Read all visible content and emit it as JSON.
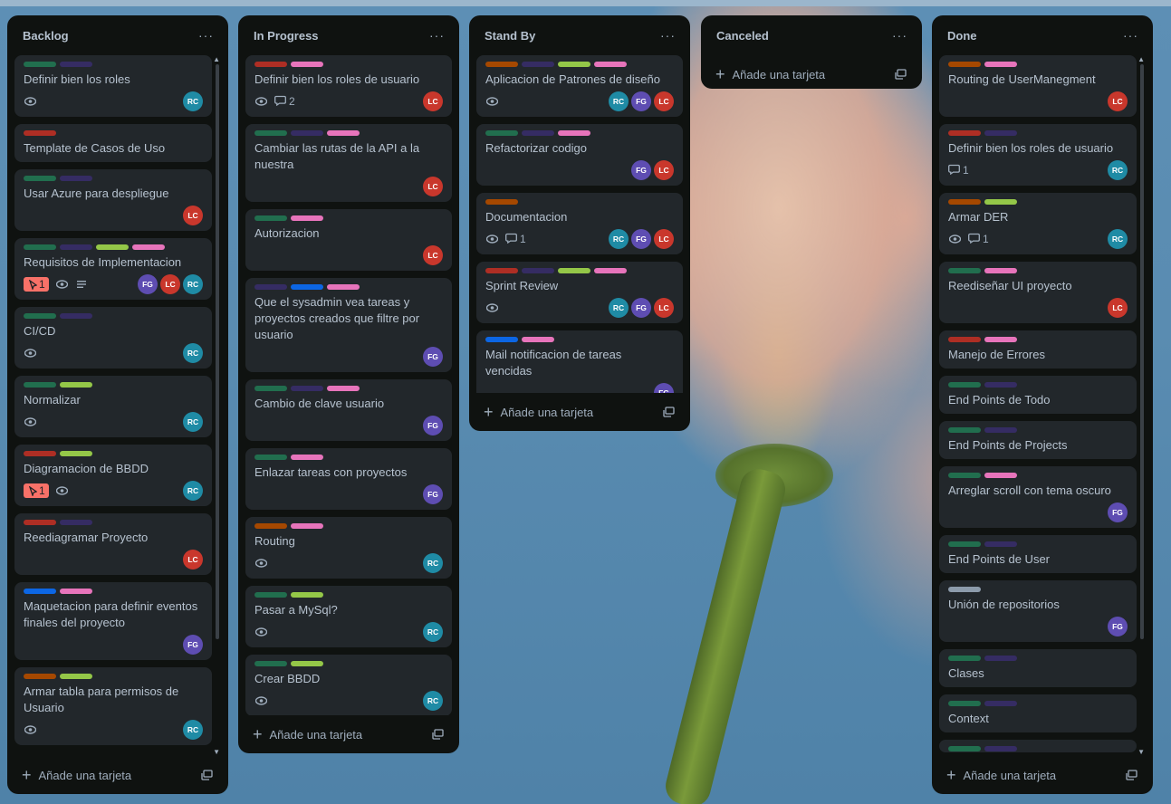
{
  "lists": [
    {
      "title": "Backlog",
      "add_label": "Añade una tarjeta",
      "cards": [
        {
          "labels": [
            "#216e4e",
            "#352c63"
          ],
          "title": "Definir bien los roles",
          "watch": true,
          "comments": "",
          "due": "",
          "desc": false,
          "members": [
            "RC"
          ]
        },
        {
          "labels": [
            "#ae2e24"
          ],
          "title": "Template de Casos de Uso",
          "watch": false,
          "comments": "",
          "due": "",
          "desc": false,
          "members": []
        },
        {
          "labels": [
            "#216e4e",
            "#352c63"
          ],
          "title": "Usar Azure para despliegue",
          "watch": false,
          "comments": "",
          "due": "",
          "desc": false,
          "members": [
            "LC"
          ]
        },
        {
          "labels": [
            "#216e4e",
            "#352c63",
            "#94c748",
            "#e774bb"
          ],
          "title": "Requisitos de Implementacion",
          "watch": true,
          "comments": "",
          "due": "1",
          "desc": true,
          "members": [
            "FG",
            "LC",
            "RC"
          ]
        },
        {
          "labels": [
            "#216e4e",
            "#352c63"
          ],
          "title": "CI/CD",
          "watch": true,
          "comments": "",
          "due": "",
          "desc": false,
          "members": [
            "RC"
          ]
        },
        {
          "labels": [
            "#216e4e",
            "#94c748"
          ],
          "title": "Normalizar",
          "watch": true,
          "comments": "",
          "due": "",
          "desc": false,
          "members": [
            "RC"
          ]
        },
        {
          "labels": [
            "#ae2e24",
            "#94c748"
          ],
          "title": "Diagramacion de BBDD",
          "watch": true,
          "comments": "",
          "due": "1",
          "desc": false,
          "members": [
            "RC"
          ]
        },
        {
          "labels": [
            "#ae2e24",
            "#352c63"
          ],
          "title": "Reediagramar Proyecto",
          "watch": false,
          "comments": "",
          "due": "",
          "desc": false,
          "members": [
            "LC"
          ]
        },
        {
          "labels": [
            "#0c66e4",
            "#e774bb"
          ],
          "title": "Maquetacion para definir eventos finales del proyecto",
          "watch": false,
          "comments": "",
          "due": "",
          "desc": false,
          "members": [
            "FG"
          ]
        },
        {
          "labels": [
            "#a54800",
            "#94c748"
          ],
          "title": "Armar tabla para permisos de Usuario",
          "watch": true,
          "comments": "",
          "due": "",
          "desc": false,
          "members": [
            "RC"
          ]
        }
      ]
    },
    {
      "title": "In Progress",
      "add_label": "Añade una tarjeta",
      "cards": [
        {
          "labels": [
            "#ae2e24",
            "#e774bb"
          ],
          "title": "Definir bien los roles de usuario",
          "watch": true,
          "comments": "2",
          "due": "",
          "desc": false,
          "members": [
            "LC"
          ]
        },
        {
          "labels": [
            "#216e4e",
            "#352c63",
            "#e774bb"
          ],
          "title": "Cambiar las rutas de la API a la nuestra",
          "watch": false,
          "comments": "",
          "due": "",
          "desc": false,
          "members": [
            "LC"
          ]
        },
        {
          "labels": [
            "#216e4e",
            "#e774bb"
          ],
          "title": "Autorizacion",
          "watch": false,
          "comments": "",
          "due": "",
          "desc": false,
          "members": [
            "LC"
          ]
        },
        {
          "labels": [
            "#352c63",
            "#0c66e4",
            "#e774bb"
          ],
          "title": "Que el sysadmin vea tareas y proyectos creados que filtre por usuario",
          "watch": false,
          "comments": "",
          "due": "",
          "desc": false,
          "members": [
            "FG"
          ]
        },
        {
          "labels": [
            "#216e4e",
            "#352c63",
            "#e774bb"
          ],
          "title": "Cambio de clave usuario",
          "watch": false,
          "comments": "",
          "due": "",
          "desc": false,
          "members": [
            "FG"
          ]
        },
        {
          "labels": [
            "#216e4e",
            "#e774bb"
          ],
          "title": "Enlazar tareas con proyectos",
          "watch": false,
          "comments": "",
          "due": "",
          "desc": false,
          "members": [
            "FG"
          ]
        },
        {
          "labels": [
            "#a54800",
            "#e774bb"
          ],
          "title": "Routing",
          "watch": true,
          "comments": "",
          "due": "",
          "desc": false,
          "members": [
            "RC"
          ]
        },
        {
          "labels": [
            "#216e4e",
            "#94c748"
          ],
          "title": "Pasar a MySql?",
          "watch": true,
          "comments": "",
          "due": "",
          "desc": false,
          "members": [
            "RC"
          ]
        },
        {
          "labels": [
            "#216e4e",
            "#94c748"
          ],
          "title": "Crear BBDD",
          "watch": true,
          "comments": "",
          "due": "",
          "desc": false,
          "members": [
            "RC"
          ]
        }
      ]
    },
    {
      "title": "Stand By",
      "add_label": "Añade una tarjeta",
      "cards": [
        {
          "labels": [
            "#a54800",
            "#352c63",
            "#94c748",
            "#e774bb"
          ],
          "title": "Aplicacion de Patrones de diseño",
          "watch": true,
          "comments": "",
          "due": "",
          "desc": false,
          "members": [
            "RC",
            "FG",
            "LC"
          ]
        },
        {
          "labels": [
            "#216e4e",
            "#352c63",
            "#e774bb"
          ],
          "title": "Refactorizar codigo",
          "watch": false,
          "comments": "",
          "due": "",
          "desc": false,
          "members": [
            "FG",
            "LC"
          ]
        },
        {
          "labels": [
            "#a54800"
          ],
          "title": "Documentacion",
          "watch": true,
          "comments": "1",
          "due": "",
          "desc": false,
          "members": [
            "RC",
            "FG",
            "LC"
          ]
        },
        {
          "labels": [
            "#ae2e24",
            "#352c63",
            "#94c748",
            "#e774bb"
          ],
          "title": "Sprint Review",
          "watch": true,
          "comments": "",
          "due": "",
          "desc": false,
          "members": [
            "RC",
            "FG",
            "LC"
          ]
        },
        {
          "labels": [
            "#0c66e4",
            "#e774bb"
          ],
          "title": "Mail notificacion de tareas vencidas",
          "watch": false,
          "comments": "",
          "due": "",
          "desc": false,
          "members": [
            "FG"
          ]
        }
      ]
    },
    {
      "title": "Canceled",
      "add_label": "Añade una tarjeta",
      "cards": []
    },
    {
      "title": "Done",
      "add_label": "Añade una tarjeta",
      "cards": [
        {
          "labels": [
            "#a54800",
            "#e774bb"
          ],
          "title": "Routing de UserManegment",
          "watch": false,
          "comments": "",
          "due": "",
          "desc": false,
          "members": [
            "LC"
          ]
        },
        {
          "labels": [
            "#ae2e24",
            "#352c63"
          ],
          "title": "Definir bien los roles de usuario",
          "watch": false,
          "comments": "1",
          "due": "",
          "desc": false,
          "members": [
            "RC"
          ]
        },
        {
          "labels": [
            "#a54800",
            "#94c748"
          ],
          "title": "Armar DER",
          "watch": true,
          "comments": "1",
          "due": "",
          "desc": false,
          "members": [
            "RC"
          ]
        },
        {
          "labels": [
            "#216e4e",
            "#e774bb"
          ],
          "title": "Reediseñar UI proyecto",
          "watch": false,
          "comments": "",
          "due": "",
          "desc": false,
          "members": [
            "LC"
          ]
        },
        {
          "labels": [
            "#ae2e24",
            "#e774bb"
          ],
          "title": "Manejo de Errores",
          "watch": false,
          "comments": "",
          "due": "",
          "desc": false,
          "members": []
        },
        {
          "labels": [
            "#216e4e",
            "#352c63"
          ],
          "title": "End Points de Todo",
          "watch": false,
          "comments": "",
          "due": "",
          "desc": false,
          "members": []
        },
        {
          "labels": [
            "#216e4e",
            "#352c63"
          ],
          "title": "End Points de Projects",
          "watch": false,
          "comments": "",
          "due": "",
          "desc": false,
          "members": []
        },
        {
          "labels": [
            "#216e4e",
            "#e774bb"
          ],
          "title": "Arreglar scroll con tema oscuro",
          "watch": false,
          "comments": "",
          "due": "",
          "desc": false,
          "members": [
            "FG"
          ]
        },
        {
          "labels": [
            "#216e4e",
            "#352c63"
          ],
          "title": "End Points de User",
          "watch": false,
          "comments": "",
          "due": "",
          "desc": false,
          "members": []
        },
        {
          "labels": [
            "#8c9bab"
          ],
          "title": "Unión de repositorios",
          "watch": false,
          "comments": "",
          "due": "",
          "desc": false,
          "members": [
            "FG"
          ]
        },
        {
          "labels": [
            "#216e4e",
            "#352c63"
          ],
          "title": "Clases",
          "watch": false,
          "comments": "",
          "due": "",
          "desc": false,
          "members": []
        },
        {
          "labels": [
            "#216e4e",
            "#352c63"
          ],
          "title": "Context",
          "watch": false,
          "comments": "",
          "due": "",
          "desc": false,
          "members": []
        },
        {
          "labels": [
            "#216e4e",
            "#352c63"
          ],
          "title": "",
          "watch": false,
          "comments": "",
          "due": "",
          "desc": false,
          "members": []
        }
      ]
    }
  ],
  "menu_glyph": "···",
  "add_glyph": "+"
}
